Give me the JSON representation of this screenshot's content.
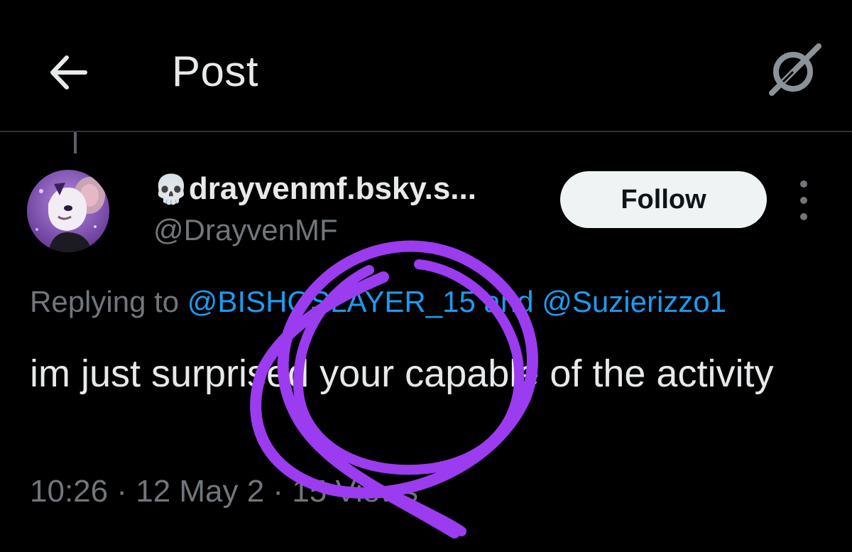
{
  "header": {
    "back_icon": "arrow-left-icon",
    "title": "Post",
    "grok_icon": "grok-icon"
  },
  "author": {
    "display_name_emoji": "💀",
    "display_name": "drayvenmf.bsky.s...",
    "handle": "@DrayvenMF",
    "avatar_icon": "avatar-image",
    "follow_label": "Follow",
    "more_icon": "more-vertical-icon"
  },
  "reply_context": {
    "prefix": "Replying to ",
    "mention_1": "@BISHOSLAYER_15",
    "joiner": " and ",
    "mention_2": "@Suzierizzo1"
  },
  "post": {
    "text": "im just surprised your capable of the activity"
  },
  "meta": {
    "time": "10:26",
    "separator": " · ",
    "date": "12 May 2",
    "views": "15 Views"
  },
  "colors": {
    "background": "#000000",
    "text_primary": "#e7e9ea",
    "text_secondary": "#71767b",
    "link": "#1d9bf0",
    "follow_bg": "#eff3f4",
    "scribble": "#9b3cf0"
  }
}
